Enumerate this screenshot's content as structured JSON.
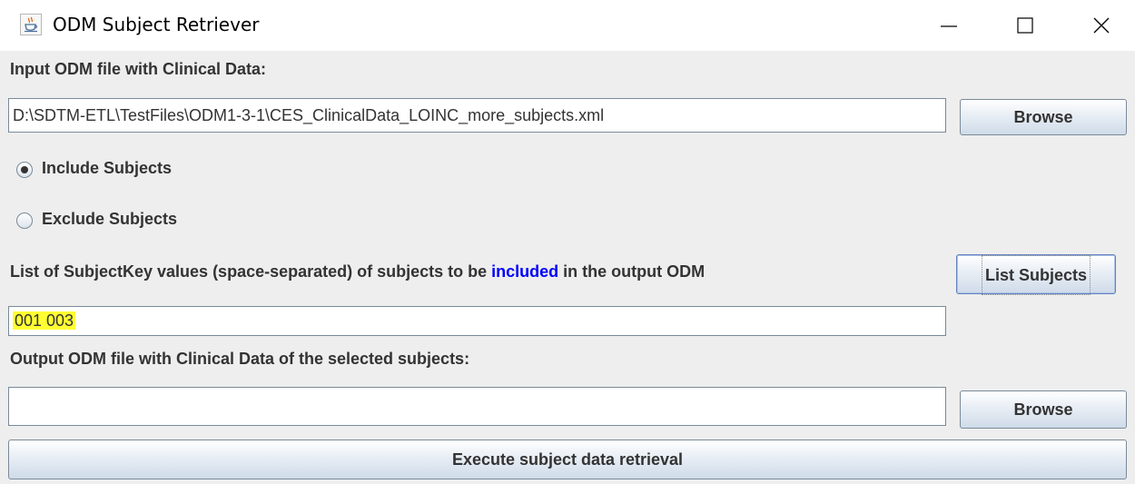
{
  "window": {
    "title": "ODM Subject Retriever",
    "icons": {
      "app": "java-coffee-cup-icon",
      "minimize": "minimize-icon",
      "maximize": "maximize-icon",
      "close": "close-icon"
    }
  },
  "input_section": {
    "label": "Input ODM file with Clinical Data:",
    "file_path": "D:\\SDTM-ETL\\TestFiles\\ODM1-3-1\\CES_ClinicalData_LOINC_more_subjects.xml",
    "browse_label": "Browse"
  },
  "mode": {
    "include_label": "Include Subjects",
    "exclude_label": "Exclude Subjects",
    "selected": "include"
  },
  "subject_keys": {
    "label_prefix": "List of SubjectKey values (space-separated) of subjects to be ",
    "label_highlight": "included",
    "label_suffix": " in the output ODM",
    "highlight_color": "#0000ff",
    "value": "001 003",
    "list_button_label": "List Subjects"
  },
  "output_section": {
    "label": "Output ODM file with Clinical Data of the selected subjects:",
    "file_path": "",
    "browse_label": "Browse"
  },
  "execute_label": "Execute subject data retrieval"
}
